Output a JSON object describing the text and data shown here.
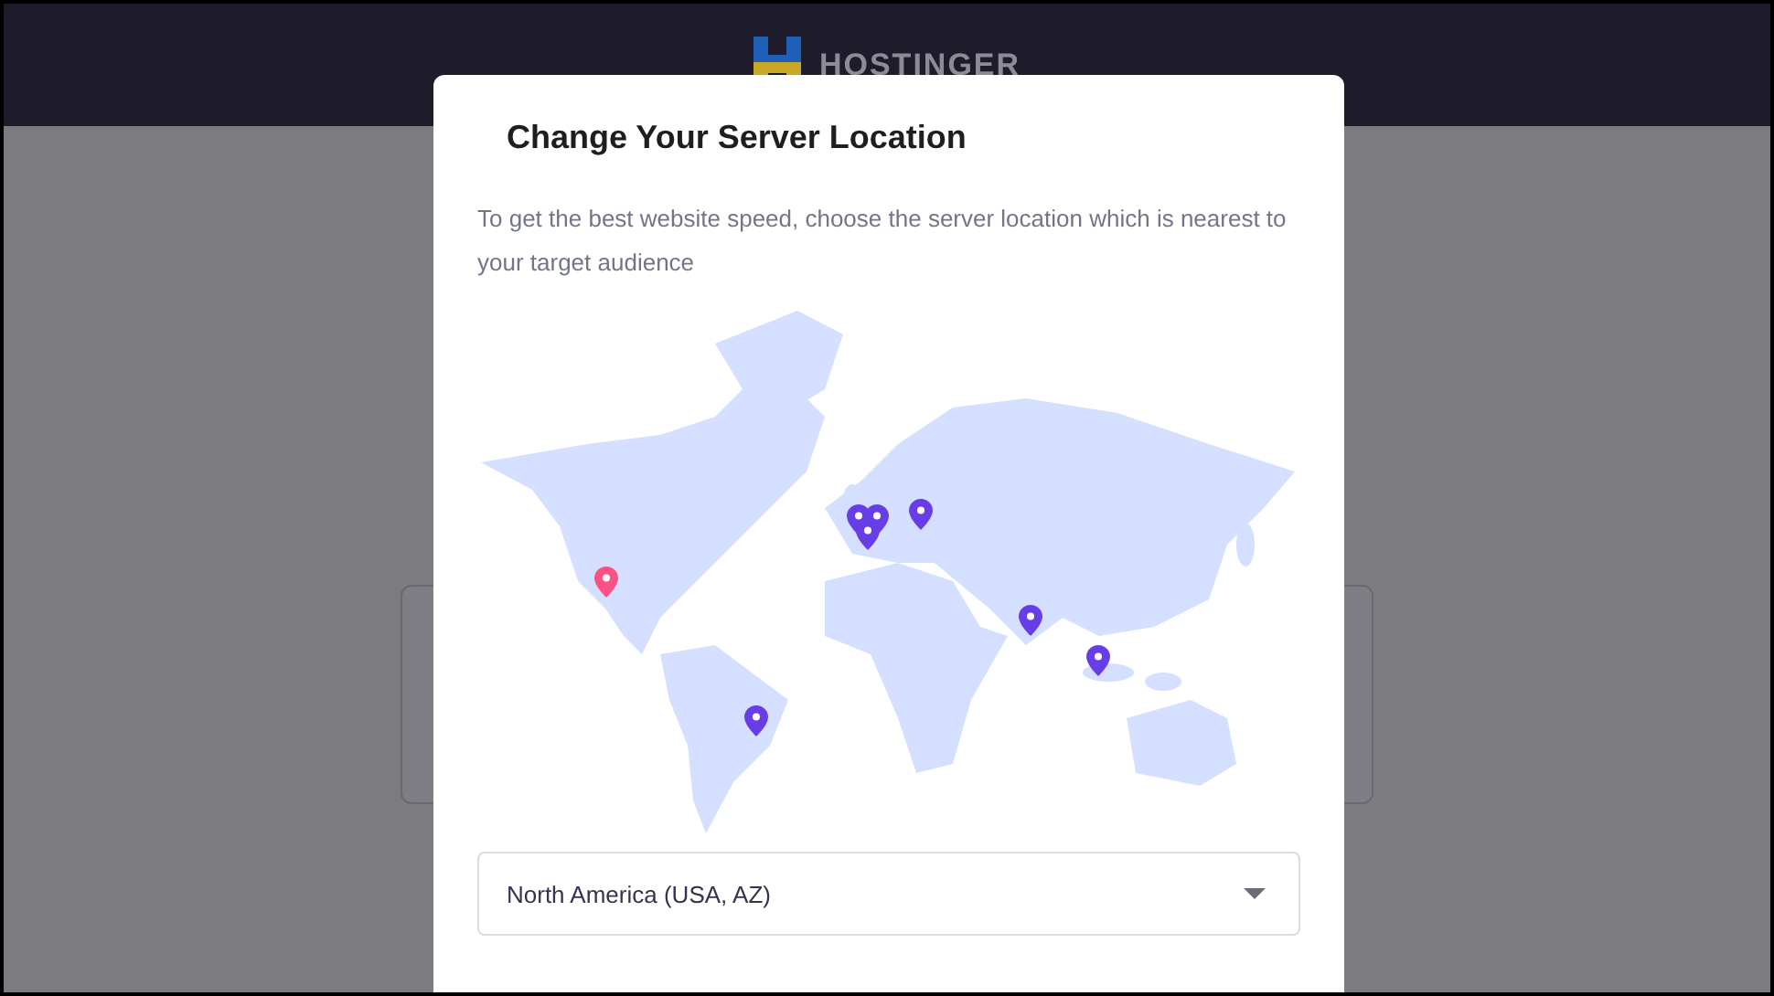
{
  "header": {
    "brand": "HOSTINGER"
  },
  "dialog": {
    "title": "Change Your Server Location",
    "description": "To get the best website speed, choose the server location which is nearest to your target audience",
    "locations": [
      {
        "selected": true
      },
      {
        "selected": false
      },
      {
        "selected": false
      },
      {
        "selected": false
      },
      {
        "selected": false
      },
      {
        "selected": false
      },
      {
        "selected": false
      },
      {
        "selected": false
      }
    ],
    "location_select": {
      "value": "North America (USA, AZ)"
    }
  }
}
